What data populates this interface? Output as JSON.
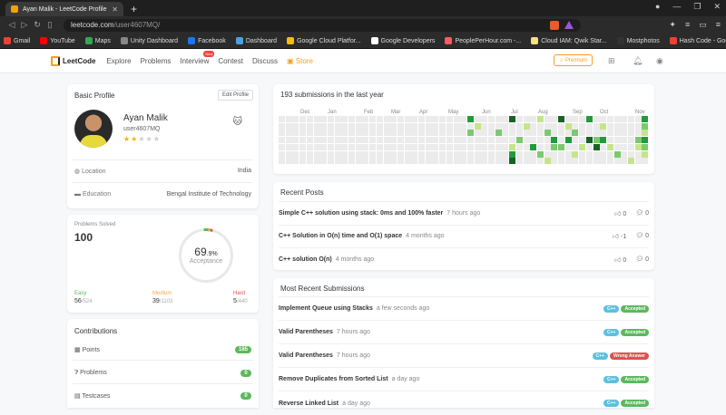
{
  "browser": {
    "tab_title": "Ayan Malik - LeetCode Profile",
    "url_host": "leetcode.com",
    "url_path": "/user4607MQ/",
    "bookmarks": [
      {
        "label": "Gmail",
        "color": "#ea4335"
      },
      {
        "label": "YouTube",
        "color": "#ff0000"
      },
      {
        "label": "Maps",
        "color": "#34a853"
      },
      {
        "label": "Unity Dashboard",
        "color": "#888888"
      },
      {
        "label": "Facebook",
        "color": "#1877f2"
      },
      {
        "label": "Dashboard",
        "color": "#4aa3df"
      },
      {
        "label": "Google Cloud Platfor...",
        "color": "#fbbc05"
      },
      {
        "label": "Google Developers",
        "color": "#ffffff"
      },
      {
        "label": "PeoplePerHour.com -...",
        "color": "#ff5a5f"
      },
      {
        "label": "Cloud IAM: Qwik Star...",
        "color": "#f7e082"
      },
      {
        "label": "Mostphotos",
        "color": "#333333"
      },
      {
        "label": "Hash Code - Google's...",
        "color": "#ea4335"
      }
    ]
  },
  "nav": {
    "logo": "LeetCode",
    "links": [
      "Explore",
      "Problems",
      "Interview",
      "Contest",
      "Discuss",
      "Store"
    ],
    "new_badge": "New",
    "premium": "Premium"
  },
  "profile": {
    "title": "Basic Profile",
    "edit": "Edit Profile",
    "name": "Ayan Malik",
    "username": "user4607MQ",
    "stars": 2,
    "location_label": "Location",
    "location": "India",
    "education_label": "Education",
    "education": "Bengal Institute of Technology"
  },
  "solved": {
    "label": "Problems Solved",
    "count": "100",
    "pct_int": "69",
    "pct_dec": ".9%",
    "acceptance": "Acceptance",
    "easy": {
      "label": "Easy",
      "value": "56",
      "total": "/524",
      "fraction": 0.107
    },
    "medium": {
      "label": "Medium",
      "value": "39",
      "total": "/1103",
      "fraction": 0.035
    },
    "hard": {
      "label": "Hard",
      "value": "5",
      "total": "/440",
      "fraction": 0.011
    }
  },
  "contributions": {
    "title": "Contributions",
    "items": [
      {
        "label": "Points",
        "value": "185"
      },
      {
        "label": "Problems",
        "value": "0"
      },
      {
        "label": "Testcases",
        "value": "0"
      }
    ]
  },
  "heatmap": {
    "title": "193 submissions in the last year",
    "months": [
      "Dec",
      "Jan",
      "Feb",
      "Mar",
      "Apr",
      "May",
      "Jun",
      "Jul",
      "Aug",
      "Sep",
      "Oct",
      "Nov"
    ]
  },
  "recent_posts": {
    "title": "Recent Posts",
    "items": [
      {
        "title": "Simple C++ solution using stack: 0ms and 100% faster",
        "time": "7 hours ago",
        "votes": "0",
        "comments": "0"
      },
      {
        "title": "C++ Solution in O(n) time and O(1) space",
        "time": "4 months ago",
        "votes": "-1",
        "comments": "0"
      },
      {
        "title": "C++ solution O(n)",
        "time": "4 months ago",
        "votes": "0",
        "comments": "0"
      }
    ]
  },
  "submissions": {
    "title": "Most Recent Submissions",
    "items": [
      {
        "title": "Implement Queue using Stacks",
        "time": "a few seconds ago",
        "lang": "C++",
        "status": "Accepted",
        "status_color": "#5cb85c"
      },
      {
        "title": "Valid Parentheses",
        "time": "7 hours ago",
        "lang": "C++",
        "status": "Accepted",
        "status_color": "#5cb85c"
      },
      {
        "title": "Valid Parentheses",
        "time": "7 hours ago",
        "lang": "C++",
        "status": "Wrong Answer",
        "status_color": "#d9534f"
      },
      {
        "title": "Remove Duplicates from Sorted List",
        "time": "a day ago",
        "lang": "C++",
        "status": "Accepted",
        "status_color": "#5cb85c"
      },
      {
        "title": "Reverse Linked List",
        "time": "a day ago",
        "lang": "C++",
        "status": "Accepted",
        "status_color": "#5cb85c"
      }
    ]
  }
}
